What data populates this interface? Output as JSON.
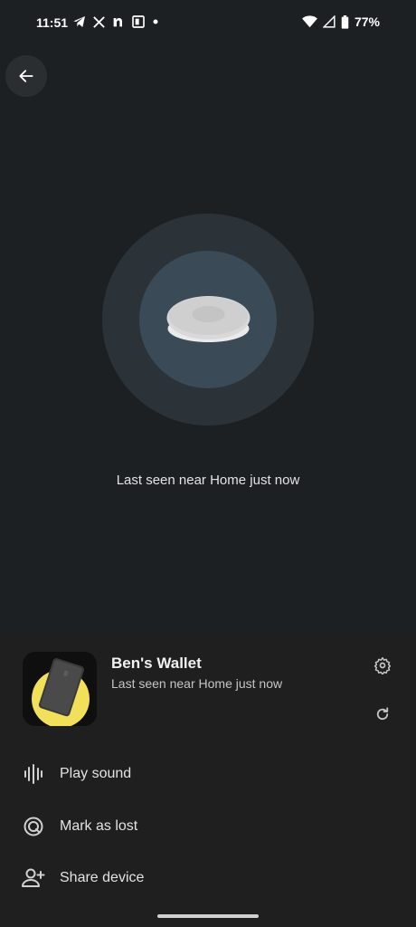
{
  "status_bar": {
    "time": "11:51",
    "notification_icons": [
      "telegram-icon",
      "x-icon",
      "n-icon",
      "news-icon",
      "dot-icon"
    ],
    "battery": "77%"
  },
  "map": {
    "last_seen": "Last seen near Home just now"
  },
  "device": {
    "name": "Ben's Wallet",
    "status": "Last seen near Home just now"
  },
  "actions": [
    {
      "label": "Play sound",
      "icon": "sound-wave-icon"
    },
    {
      "label": "Mark as lost",
      "icon": "lost-icon"
    },
    {
      "label": "Share device",
      "icon": "add-person-icon"
    }
  ],
  "colors": {
    "background": "#1d2023",
    "sheet": "#1f1f1f",
    "ring_outer": "#2b3339",
    "ring_inner": "#3a4a57",
    "accent_yellow": "#f3e05a"
  }
}
